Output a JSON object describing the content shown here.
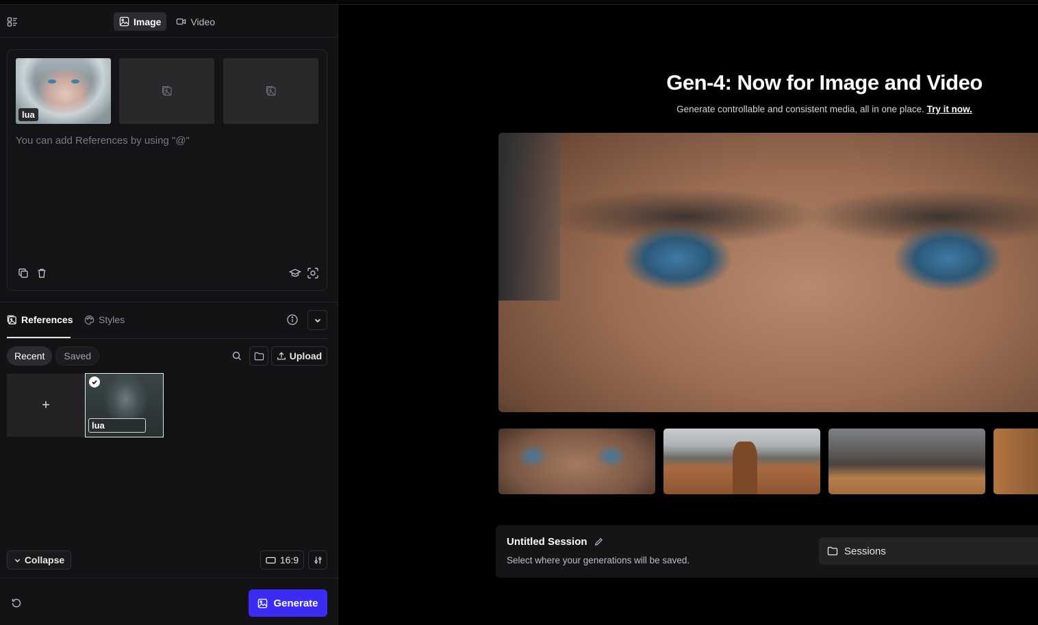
{
  "mode_tabs": [
    {
      "label": "Image",
      "active": true
    },
    {
      "label": "Video",
      "active": false
    }
  ],
  "prompt": {
    "reference_tag": "lua",
    "placeholder": "You can add References by using \"@\""
  },
  "references": {
    "tabs": [
      {
        "label": "References",
        "active": true
      },
      {
        "label": "Styles",
        "active": false
      }
    ],
    "filters": [
      {
        "label": "Recent",
        "active": true
      },
      {
        "label": "Saved",
        "active": false
      }
    ],
    "upload_label": "Upload",
    "add_symbol": "+",
    "selected_tag_value": "lua"
  },
  "footer": {
    "collapse_label": "Collapse",
    "aspect_ratio": "16:9",
    "generate_label": "Generate"
  },
  "hero": {
    "title": "Gen-4: Now for Image and Video",
    "subtitle": "Generate controllable and consistent media, all in one place.",
    "cta_link": "Try it now."
  },
  "session": {
    "title": "Untitled Session",
    "subtitle": "Select where your generations will be saved.",
    "sessions_label": "Sessions"
  },
  "colors": {
    "accent": "#3b2cf5",
    "panel_bg": "#131315",
    "page_bg": "#000000"
  }
}
